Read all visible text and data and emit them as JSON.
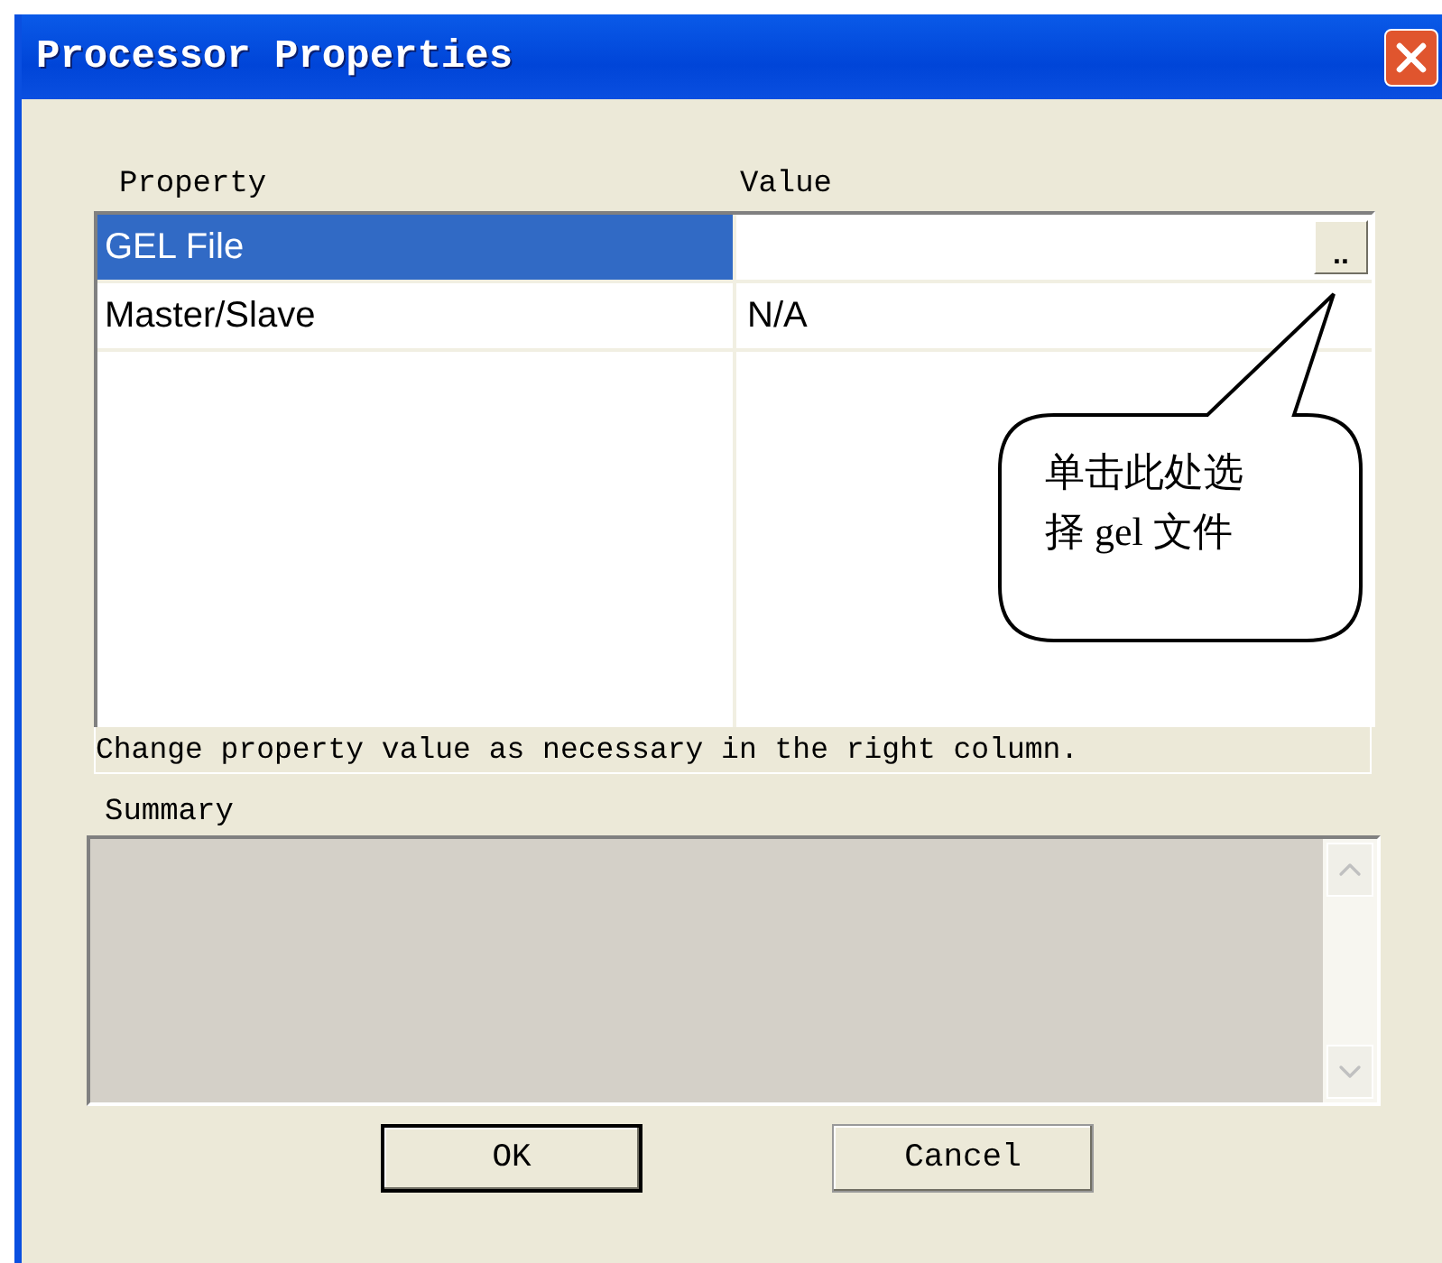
{
  "window": {
    "title": "Processor Properties"
  },
  "table": {
    "columns": [
      "Property",
      "Value"
    ],
    "rows": [
      {
        "property": "GEL File",
        "value": "",
        "selected": true,
        "browse": ".."
      },
      {
        "property": "Master/Slave",
        "value": "N/A",
        "selected": false
      }
    ]
  },
  "callout": {
    "text": "单击此处选择 gel 文件"
  },
  "hint": "Change property value as necessary in the right column.",
  "summary": {
    "label": "Summary"
  },
  "buttons": [
    {
      "label": "OK",
      "default": true
    },
    {
      "label": "Cancel",
      "default": false
    }
  ]
}
